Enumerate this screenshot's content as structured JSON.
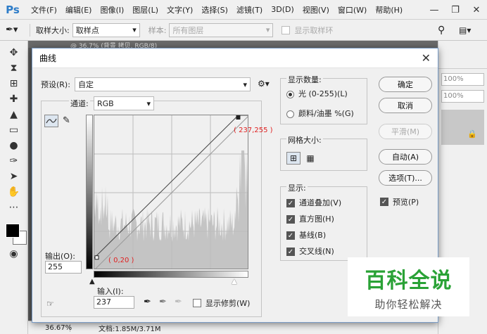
{
  "app": {
    "logo": "Ps",
    "menus": [
      "文件(F)",
      "编辑(E)",
      "图像(I)",
      "图层(L)",
      "文字(Y)",
      "选择(S)",
      "滤镜(T)",
      "3D(D)",
      "视图(V)",
      "窗口(W)",
      "帮助(H)"
    ]
  },
  "options_bar": {
    "sample_size_label": "取样大小:",
    "sample_size_value": "取样点",
    "sample_label": "样本:",
    "sample_value": "所有图层",
    "show_ring_label": "显示取样环"
  },
  "tab": {
    "title": "@ 36.7% (背景 拷贝, RGB/8)"
  },
  "right_panel": {
    "zoom1": "100%",
    "zoom2": "100%"
  },
  "status": {
    "zoom": "36.67%",
    "doc": "文档:1.85M/3.71M"
  },
  "dialog": {
    "title": "曲线",
    "preset_label": "预设(R):",
    "preset_value": "自定",
    "channel_label": "通道:",
    "channel_value": "RGB",
    "point_top": "( 237,255 )",
    "point_bottom": "( 0,20 )",
    "output_label": "输出(O):",
    "output_value": "255",
    "input_label": "输入(I):",
    "input_value": "237",
    "show_clipping": "显示修剪(W)",
    "display_amount": {
      "title": "显示数量:",
      "light": "光 (0-255)(L)",
      "pigment": "颜料/油墨 %(G)"
    },
    "grid_size": {
      "title": "网格大小:"
    },
    "show": {
      "title": "显示:",
      "items": [
        "通道叠加(V)",
        "直方图(H)",
        "基线(B)",
        "交叉线(N)"
      ]
    },
    "buttons": {
      "ok": "确定",
      "cancel": "取消",
      "smooth": "平滑(M)",
      "auto": "自动(A)",
      "options": "选项(T)..."
    },
    "preview": "预览(P)"
  },
  "watermark": {
    "title": "百科全说",
    "subtitle": "助你轻松解决"
  },
  "colors": {
    "ps_blue": "#2d7cc8",
    "watermark_green": "#2aa236",
    "point_red": "#e02020"
  }
}
